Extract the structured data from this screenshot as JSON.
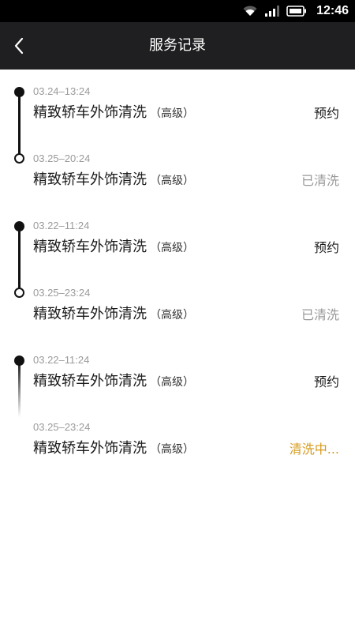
{
  "status_bar": {
    "time": "12:46",
    "icons": [
      "wifi-icon",
      "signal-icon",
      "battery-icon"
    ]
  },
  "nav": {
    "title": "服务记录",
    "back_icon": "chevron-left-icon"
  },
  "colors": {
    "nav_background": "#1f1f21",
    "status_pending": "#d69a1b",
    "status_done": "#999999"
  },
  "groups": [
    {
      "line_style": "solid",
      "records": [
        {
          "date": "03.24–13:24",
          "title": "精致轿车外饰清洗",
          "level": "（高级）",
          "status": "预约"
        },
        {
          "date": "03.25–20:24",
          "title": "精致轿车外饰清洗",
          "level": "（高级）",
          "status": "已清洗"
        }
      ]
    },
    {
      "line_style": "solid",
      "records": [
        {
          "date": "03.22–11:24",
          "title": "精致轿车外饰清洗",
          "level": "（高级）",
          "status": "预约"
        },
        {
          "date": "03.25–23:24",
          "title": "精致轿车外饰清洗",
          "level": "（高级）",
          "status": "已清洗"
        }
      ]
    },
    {
      "line_style": "fading",
      "records": [
        {
          "date": "03.22–11:24",
          "title": "精致轿车外饰清洗",
          "level": "（高级）",
          "status": "预约"
        },
        {
          "date": "03.25–23:24",
          "title": "精致轿车外饰清洗",
          "level": "（高级）",
          "status": "清洗中..."
        }
      ]
    }
  ]
}
